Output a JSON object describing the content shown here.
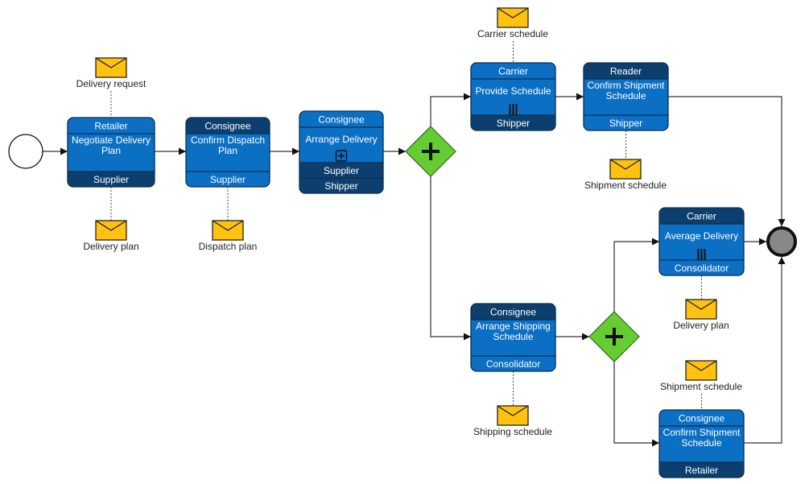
{
  "diagram": {
    "type": "BPMN choreography diagram",
    "colors": {
      "band_light": "#0b6fc4",
      "band_dark": "#0d3f6e",
      "task_border": "#0a2e50",
      "gateway_fill": "#66cc33",
      "gateway_border": "#2d6b12",
      "envelope_fill": "#ffc20e",
      "end_fill": "#888888"
    },
    "start_event": {
      "name": "start-event"
    },
    "end_event": {
      "name": "end-event"
    },
    "tasks": [
      {
        "id": "t1",
        "top_participant": "Retailer",
        "name_lines": [
          "Negotiate Delivery",
          "Plan"
        ],
        "bottom_participants": [
          "Supplier"
        ],
        "initiator": "top",
        "marker": "none"
      },
      {
        "id": "t2",
        "top_participant": "Consignee",
        "name_lines": [
          "Confirm Dispatch",
          "Plan"
        ],
        "bottom_participants": [
          "Supplier"
        ],
        "initiator": "bottom",
        "marker": "none"
      },
      {
        "id": "t3",
        "top_participant": "Consignee",
        "name_lines": [
          "Arrange Delivery"
        ],
        "bottom_participants": [
          "Supplier",
          "Shipper"
        ],
        "initiator": "top",
        "marker": "subprocess"
      },
      {
        "id": "t4",
        "top_participant": "Carrier",
        "name_lines": [
          "Provide Schedule"
        ],
        "bottom_participants": [
          "Shipper"
        ],
        "initiator": "top",
        "marker": "parallel"
      },
      {
        "id": "t5",
        "top_participant": "Reader",
        "name_lines": [
          "Confirm Shipment",
          "Schedule"
        ],
        "bottom_participants": [
          "Shipper"
        ],
        "initiator": "bottom",
        "marker": "none"
      },
      {
        "id": "t6",
        "top_participant": "Carrier",
        "name_lines": [
          "Average Delivery"
        ],
        "bottom_participants": [
          "Consolidator"
        ],
        "initiator": "bottom",
        "marker": "parallel"
      },
      {
        "id": "t7",
        "top_participant": "Consignee",
        "name_lines": [
          "Arrange Shipping",
          "Schedule"
        ],
        "bottom_participants": [
          "Consolidator"
        ],
        "initiator": "bottom",
        "marker": "none"
      },
      {
        "id": "t8",
        "top_participant": "Consignee",
        "name_lines": [
          "Confirm Shipment",
          "Schedule"
        ],
        "bottom_participants": [
          "Retailer"
        ],
        "initiator": "top",
        "marker": "none"
      }
    ],
    "gateways": [
      {
        "id": "g1",
        "type": "parallel",
        "symbol": "+"
      },
      {
        "id": "g2",
        "type": "parallel",
        "symbol": "+"
      }
    ],
    "messages": [
      {
        "id": "m1",
        "label": "Delivery request",
        "task": "t1"
      },
      {
        "id": "m2",
        "label": "Delivery plan",
        "task": "t1"
      },
      {
        "id": "m3",
        "label": "Dispatch plan",
        "task": "t2"
      },
      {
        "id": "m4",
        "label": "Carrier schedule",
        "task": "t4"
      },
      {
        "id": "m5",
        "label": "Shipment schedule",
        "task": "t5"
      },
      {
        "id": "m6",
        "label": "Delivery plan",
        "task": "t6"
      },
      {
        "id": "m7",
        "label": "Shipping schedule",
        "task": "t7"
      },
      {
        "id": "m8",
        "label": "Shipment schedule",
        "task": "t8"
      }
    ],
    "sequence_flows": [
      [
        "start",
        "t1"
      ],
      [
        "t1",
        "t2"
      ],
      [
        "t2",
        "t3"
      ],
      [
        "t3",
        "g1"
      ],
      [
        "g1",
        "t4"
      ],
      [
        "g1",
        "t7"
      ],
      [
        "t4",
        "t5"
      ],
      [
        "t5",
        "end"
      ],
      [
        "t7",
        "g2"
      ],
      [
        "g2",
        "t6"
      ],
      [
        "g2",
        "t8"
      ],
      [
        "t6",
        "end"
      ],
      [
        "t8",
        "end"
      ]
    ]
  }
}
